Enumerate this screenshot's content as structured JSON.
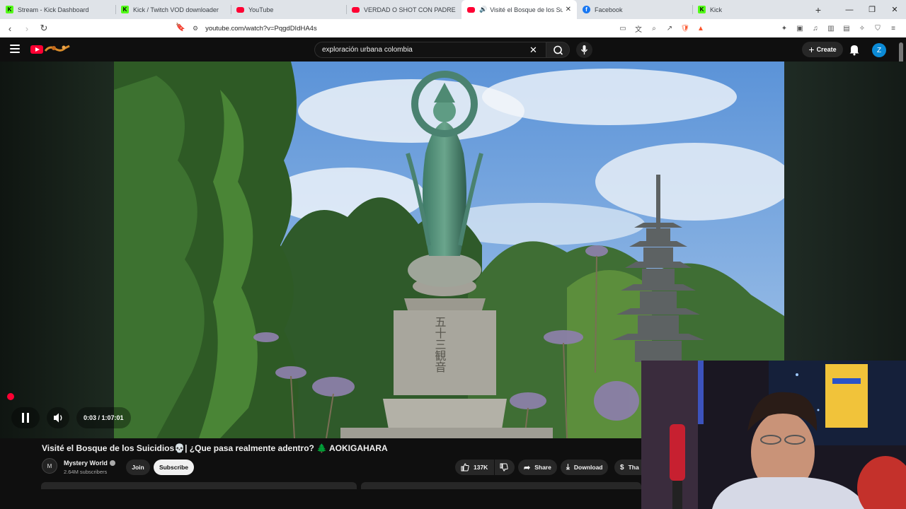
{
  "browser": {
    "tabs": [
      {
        "label": "Stream - Kick Dashboard",
        "favicon": "kick-icon",
        "active": false
      },
      {
        "label": "Kick / Twitch VOD downloader",
        "favicon": "kick-icon",
        "active": false
      },
      {
        "label": "YouTube",
        "favicon": "youtube-icon",
        "active": false
      },
      {
        "label": "VERDAD O SHOT CON PADRES PART",
        "favicon": "youtube-icon",
        "active": false
      },
      {
        "label": "Visité el Bosque de los Suicidi",
        "favicon": "youtube-icon",
        "active": true
      },
      {
        "label": "Facebook",
        "favicon": "facebook-icon",
        "active": false
      },
      {
        "label": "Kick",
        "favicon": "kick-icon",
        "active": false
      }
    ],
    "url": "youtube.com/watch?v=PqgdDIdHA4s"
  },
  "youtube": {
    "search_query": "exploración urbana colombia",
    "create_label": "Create",
    "avatar_letter": "Z"
  },
  "player": {
    "time": "0:03 / 1:07:01",
    "state": "playing",
    "progress_fraction": 0.001
  },
  "video": {
    "title": "Visité el Bosque de los Suicidios💀| ¿Que pasa realmente adentro? 🌲 AOKIGAHARA",
    "channel": "Mystery World",
    "subscribers": "2.64M subscribers",
    "join_label": "Join",
    "subscribe_label": "Subscribe",
    "likes": "137K",
    "share_label": "Share",
    "download_label": "Download",
    "thanks_label": "Tha"
  },
  "colors": {
    "youtube_red": "#ff0033",
    "kick_green": "#53fc18",
    "facebook_blue": "#1877f2",
    "avatar_blue": "#0b8ad6"
  }
}
